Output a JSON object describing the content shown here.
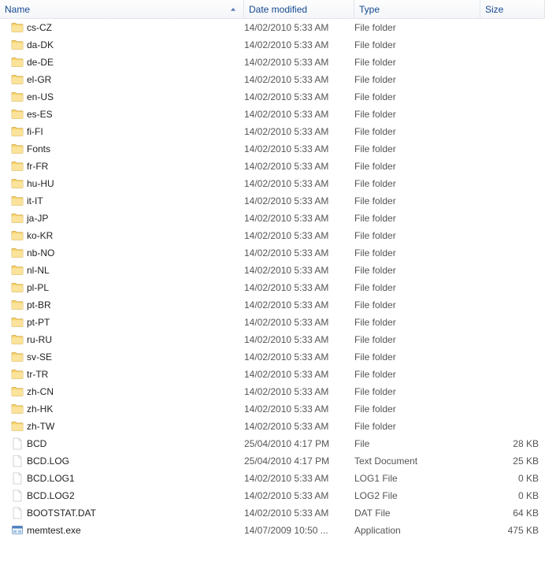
{
  "columns": {
    "name": {
      "label": "Name",
      "sorted": true,
      "dir": "asc"
    },
    "date": {
      "label": "Date modified",
      "sorted": false
    },
    "type": {
      "label": "Type",
      "sorted": false
    },
    "size": {
      "label": "Size",
      "sorted": false
    }
  },
  "rows": [
    {
      "icon": "folder",
      "name": "cs-CZ",
      "date": "14/02/2010 5:33 AM",
      "type": "File folder",
      "size": ""
    },
    {
      "icon": "folder",
      "name": "da-DK",
      "date": "14/02/2010 5:33 AM",
      "type": "File folder",
      "size": ""
    },
    {
      "icon": "folder",
      "name": "de-DE",
      "date": "14/02/2010 5:33 AM",
      "type": "File folder",
      "size": ""
    },
    {
      "icon": "folder",
      "name": "el-GR",
      "date": "14/02/2010 5:33 AM",
      "type": "File folder",
      "size": ""
    },
    {
      "icon": "folder",
      "name": "en-US",
      "date": "14/02/2010 5:33 AM",
      "type": "File folder",
      "size": ""
    },
    {
      "icon": "folder",
      "name": "es-ES",
      "date": "14/02/2010 5:33 AM",
      "type": "File folder",
      "size": ""
    },
    {
      "icon": "folder",
      "name": "fi-FI",
      "date": "14/02/2010 5:33 AM",
      "type": "File folder",
      "size": ""
    },
    {
      "icon": "folder",
      "name": "Fonts",
      "date": "14/02/2010 5:33 AM",
      "type": "File folder",
      "size": ""
    },
    {
      "icon": "folder",
      "name": "fr-FR",
      "date": "14/02/2010 5:33 AM",
      "type": "File folder",
      "size": ""
    },
    {
      "icon": "folder",
      "name": "hu-HU",
      "date": "14/02/2010 5:33 AM",
      "type": "File folder",
      "size": ""
    },
    {
      "icon": "folder",
      "name": "it-IT",
      "date": "14/02/2010 5:33 AM",
      "type": "File folder",
      "size": ""
    },
    {
      "icon": "folder",
      "name": "ja-JP",
      "date": "14/02/2010 5:33 AM",
      "type": "File folder",
      "size": ""
    },
    {
      "icon": "folder",
      "name": "ko-KR",
      "date": "14/02/2010 5:33 AM",
      "type": "File folder",
      "size": ""
    },
    {
      "icon": "folder",
      "name": "nb-NO",
      "date": "14/02/2010 5:33 AM",
      "type": "File folder",
      "size": ""
    },
    {
      "icon": "folder",
      "name": "nl-NL",
      "date": "14/02/2010 5:33 AM",
      "type": "File folder",
      "size": ""
    },
    {
      "icon": "folder",
      "name": "pl-PL",
      "date": "14/02/2010 5:33 AM",
      "type": "File folder",
      "size": ""
    },
    {
      "icon": "folder",
      "name": "pt-BR",
      "date": "14/02/2010 5:33 AM",
      "type": "File folder",
      "size": ""
    },
    {
      "icon": "folder",
      "name": "pt-PT",
      "date": "14/02/2010 5:33 AM",
      "type": "File folder",
      "size": ""
    },
    {
      "icon": "folder",
      "name": "ru-RU",
      "date": "14/02/2010 5:33 AM",
      "type": "File folder",
      "size": ""
    },
    {
      "icon": "folder",
      "name": "sv-SE",
      "date": "14/02/2010 5:33 AM",
      "type": "File folder",
      "size": ""
    },
    {
      "icon": "folder",
      "name": "tr-TR",
      "date": "14/02/2010 5:33 AM",
      "type": "File folder",
      "size": ""
    },
    {
      "icon": "folder",
      "name": "zh-CN",
      "date": "14/02/2010 5:33 AM",
      "type": "File folder",
      "size": ""
    },
    {
      "icon": "folder",
      "name": "zh-HK",
      "date": "14/02/2010 5:33 AM",
      "type": "File folder",
      "size": ""
    },
    {
      "icon": "folder",
      "name": "zh-TW",
      "date": "14/02/2010 5:33 AM",
      "type": "File folder",
      "size": ""
    },
    {
      "icon": "file",
      "name": "BCD",
      "date": "25/04/2010 4:17 PM",
      "type": "File",
      "size": "28 KB"
    },
    {
      "icon": "file",
      "name": "BCD.LOG",
      "date": "25/04/2010 4:17 PM",
      "type": "Text Document",
      "size": "25 KB"
    },
    {
      "icon": "file",
      "name": "BCD.LOG1",
      "date": "14/02/2010 5:33 AM",
      "type": "LOG1 File",
      "size": "0 KB"
    },
    {
      "icon": "file",
      "name": "BCD.LOG2",
      "date": "14/02/2010 5:33 AM",
      "type": "LOG2 File",
      "size": "0 KB"
    },
    {
      "icon": "file",
      "name": "BOOTSTAT.DAT",
      "date": "14/02/2010 5:33 AM",
      "type": "DAT File",
      "size": "64 KB"
    },
    {
      "icon": "exe",
      "name": "memtest.exe",
      "date": "14/07/2009 10:50 ...",
      "type": "Application",
      "size": "475 KB"
    }
  ]
}
